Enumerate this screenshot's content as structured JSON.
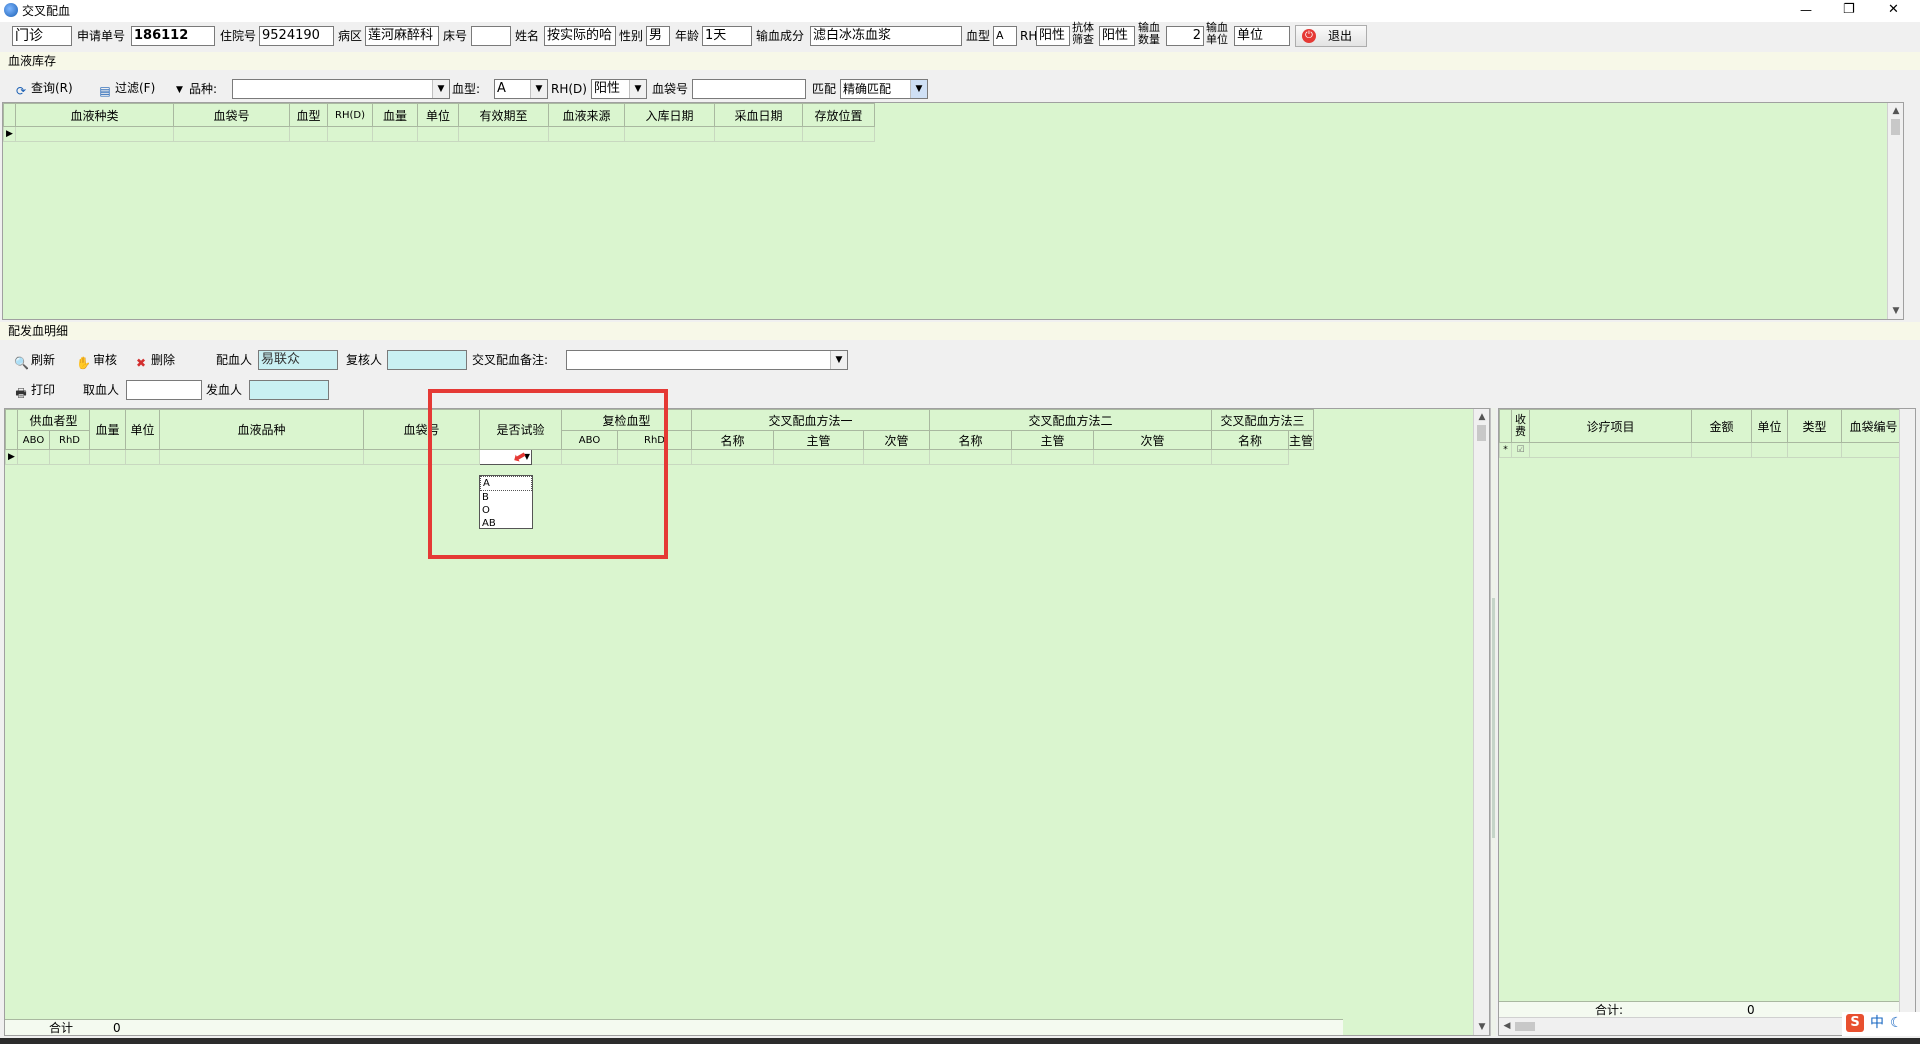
{
  "window": {
    "title": "交叉配血",
    "minimize": "—",
    "restore": "❐",
    "close": "✕"
  },
  "patient": {
    "type_value": "门诊",
    "req_label": "申请单号",
    "req_value": "186112",
    "inpatient_label": "住院号",
    "inpatient_value": "9524190",
    "ward_label": "病区",
    "ward_value": "莲河麻醉科",
    "bed_label": "床号",
    "bed_value": "",
    "name_label": "姓名",
    "name_value": "按实际的哈",
    "sex_label": "性别",
    "sex_value": "男",
    "age_label": "年龄",
    "age_value": "1天",
    "component_label": "输血成分",
    "component_value": "滤白冰冻血浆",
    "bloodtype_label": "血型",
    "bloodtype_value": "A",
    "rh_label": "RH",
    "rh_value": "阳性",
    "antibody_label_1": "抗体",
    "antibody_label_2": "筛查",
    "antibody_value": "阳性",
    "qty_label_1": "输血",
    "qty_label_2": "数量",
    "qty_value": "2",
    "unit_label_1": "输血",
    "unit_label_2": "单位",
    "unit_value": "单位",
    "exit_label": "退出"
  },
  "stock": {
    "section_title": "血液库存",
    "query_label": "查询(R)",
    "filter_label": "过滤(F)",
    "variety_label": "品种:",
    "variety_value": "",
    "bloodtype_label": "血型:",
    "bloodtype_value": "A",
    "rh_label": "RH(D)",
    "rh_value": "阳性",
    "bag_label": "血袋号",
    "bag_value": "",
    "match_label": "匹配",
    "match_value": "精确匹配",
    "columns": [
      "血液种类",
      "血袋号",
      "血型",
      "RH(D)",
      "血量",
      "单位",
      "有效期至",
      "血液来源",
      "入库日期",
      "采血日期",
      "存放位置"
    ]
  },
  "detail": {
    "section_title": "配发血明细",
    "refresh_label": "刷新",
    "audit_label": "审核",
    "delete_label": "删除",
    "print_label": "打印",
    "matcher_label": "配血人",
    "matcher_value": "易联众",
    "reviewer_label": "复核人",
    "reviewer_value": "",
    "remark_label": "交叉配血备注:",
    "remark_value": "",
    "taker_label": "取血人",
    "taker_value": "",
    "issuer_label": "发血人",
    "issuer_value": "",
    "group_donor_type": "供血者型",
    "col_abo": "ABO",
    "col_rhd": "RhD",
    "col_volume": "血量",
    "col_unit": "单位",
    "col_variety": "血液品种",
    "col_bag": "血袋号",
    "col_test": "是否试验",
    "group_recheck": "复检血型",
    "group_method1": "交叉配血方法一",
    "group_method2": "交叉配血方法二",
    "group_method3": "交叉配血方法三",
    "col_name": "名称",
    "col_main": "主管",
    "col_minor": "次管",
    "dropdown_options": [
      "A",
      "B",
      "O",
      "AB"
    ],
    "total_label": "合计",
    "total_value": "0"
  },
  "fee": {
    "col_charge": "收费",
    "col_item": "诊疗项目",
    "col_amount": "金额",
    "col_unit": "单位",
    "col_type": "类型",
    "col_bag": "血袋编号",
    "total_label": "合计:",
    "total_value": "0"
  },
  "tray": {
    "ime": "中"
  },
  "colors": {
    "grid_bg": "#daf5cf",
    "highlight_box": "#e53935",
    "cyan_field": "#c9f0f3"
  }
}
